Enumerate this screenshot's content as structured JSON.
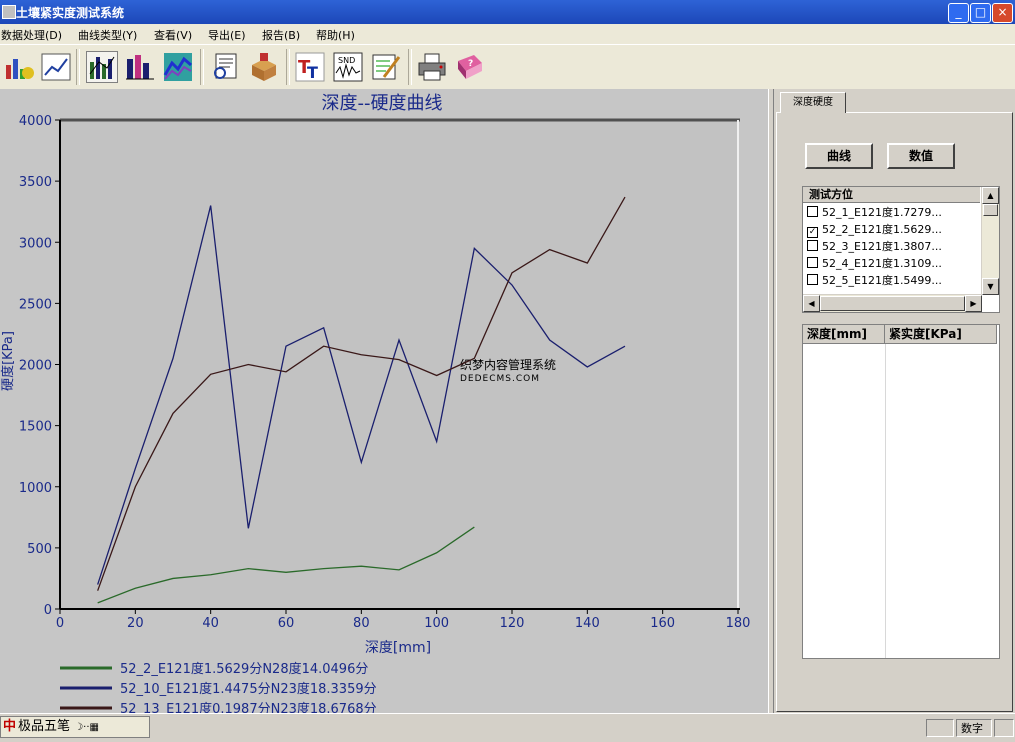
{
  "window": {
    "title": "土壤紧实度测试系统",
    "minimize": "_",
    "maximize": "□",
    "close": "×"
  },
  "menu": [
    "数据处理(D)",
    "曲线类型(Y)",
    "查看(V)",
    "导出(E)",
    "报告(B)",
    "帮助(H)"
  ],
  "toolbar": {
    "buttons": [
      {
        "icon": "bar-chart-icon"
      },
      {
        "icon": "line-chart-icon"
      },
      {
        "icon": "multi-bar-icon"
      },
      {
        "icon": "stacked-bar-icon"
      },
      {
        "icon": "area-chart-icon"
      },
      {
        "icon": "print-preview-icon"
      },
      {
        "icon": "export-box-icon"
      },
      {
        "icon": "font-tt-icon"
      },
      {
        "icon": "snd-icon"
      },
      {
        "icon": "edit-pencil-icon"
      },
      {
        "icon": "printer-icon"
      },
      {
        "icon": "help-book-icon"
      }
    ]
  },
  "chart_data": {
    "type": "line",
    "title": "深度--硬度曲线",
    "xlabel": "深度[mm]",
    "ylabel": "硬度[KPa]",
    "xlim": [
      0,
      180
    ],
    "ylim": [
      0,
      4000
    ],
    "xticks": [
      0,
      20,
      40,
      60,
      80,
      100,
      120,
      140,
      160,
      180
    ],
    "yticks": [
      0,
      500,
      1000,
      1500,
      2000,
      2500,
      3000,
      3500,
      4000
    ],
    "grid": false,
    "legend_position": "bottom-left",
    "watermark": {
      "line1": "织梦内容管理系统",
      "line2": "DEDECMS.COM"
    },
    "series": [
      {
        "name": "52_2_E121度1.5629分N28度14.0496分",
        "color": "#2a6a2a",
        "x": [
          10,
          20,
          30,
          40,
          50,
          60,
          70,
          80,
          90,
          100,
          110
        ],
        "y": [
          50,
          170,
          250,
          280,
          330,
          300,
          330,
          350,
          320,
          460,
          670
        ]
      },
      {
        "name": "52_10_E121度1.4475分N23度18.3359分",
        "color": "#1a1f6e",
        "x": [
          10,
          20,
          30,
          40,
          50,
          60,
          70,
          80,
          90,
          100,
          110,
          120,
          130,
          140,
          150
        ],
        "y": [
          200,
          1150,
          2050,
          3300,
          660,
          2150,
          2300,
          1200,
          2200,
          1370,
          2950,
          2650,
          2200,
          1980,
          2150
        ]
      },
      {
        "name": "52_13_E121度0.1987分N23度18.6768分",
        "color": "#3a1818",
        "x": [
          10,
          20,
          30,
          40,
          50,
          60,
          70,
          80,
          90,
          100,
          110,
          120,
          130,
          140,
          150
        ],
        "y": [
          150,
          1000,
          1600,
          1920,
          2000,
          1940,
          2150,
          2080,
          2040,
          1910,
          2050,
          2750,
          2940,
          2830,
          3370
        ]
      }
    ]
  },
  "right_panel": {
    "tab": "深度硬度",
    "curve_button": "曲线",
    "value_button": "数值",
    "list_header": "测试方位",
    "items": [
      {
        "label": "52_1_E121度1.7279...",
        "checked": false,
        "mark": ""
      },
      {
        "label": "52_2_E121度1.5629...",
        "checked": true,
        "mark": "✓"
      },
      {
        "label": "52_3_E121度1.3807...",
        "checked": false,
        "mark": ""
      },
      {
        "label": "52_4_E121度1.3109...",
        "checked": false,
        "mark": ""
      },
      {
        "label": "52_5_E121度1.5499...",
        "checked": false,
        "mark": ""
      }
    ],
    "table_headers": [
      "深度[mm]",
      "紧实度[KPa]"
    ]
  },
  "taskbar": {
    "ime_label": "极品五笔"
  },
  "status": {
    "cells": [
      "",
      "数字",
      ""
    ]
  }
}
